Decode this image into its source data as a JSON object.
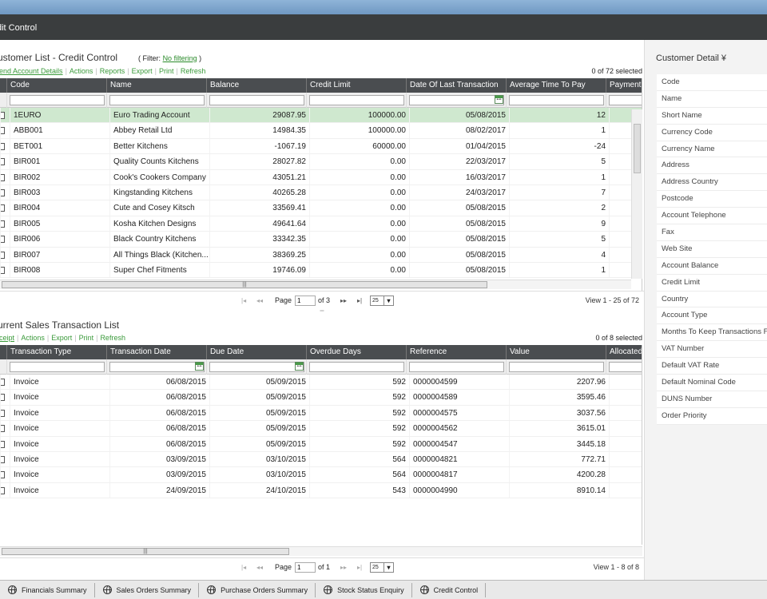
{
  "title_bar": {
    "title": "dit Control"
  },
  "customer_list": {
    "title": "ustomer List - Credit Control",
    "filter_prefix": "( Filter:",
    "filter_link": "No filtering",
    "filter_suffix": ")",
    "actions": [
      "end Account Details",
      "Actions",
      "Reports",
      "Export",
      "Print",
      "Refresh"
    ],
    "selected": "0 of 72 selected",
    "columns": [
      "Code",
      "Name",
      "Balance",
      "Credit Limit",
      "Date Of Last Transaction",
      "Average Time To Pay",
      "Payment T"
    ],
    "rows": [
      {
        "code": "1EURO",
        "name": "Euro Trading Account",
        "balance": "29087.95",
        "credit_limit": "100000.00",
        "date": "05/08/2015",
        "avg": "12"
      },
      {
        "code": "ABB001",
        "name": "Abbey Retail Ltd",
        "balance": "14984.35",
        "credit_limit": "100000.00",
        "date": "08/02/2017",
        "avg": "1"
      },
      {
        "code": "BET001",
        "name": "Better Kitchens",
        "balance": "-1067.19",
        "credit_limit": "60000.00",
        "date": "01/04/2015",
        "avg": "-24"
      },
      {
        "code": "BIR001",
        "name": "Quality Counts Kitchens",
        "balance": "28027.82",
        "credit_limit": "0.00",
        "date": "22/03/2017",
        "avg": "5"
      },
      {
        "code": "BIR002",
        "name": "Cook's Cookers Company",
        "balance": "43051.21",
        "credit_limit": "0.00",
        "date": "16/03/2017",
        "avg": "1"
      },
      {
        "code": "BIR003",
        "name": "Kingstanding Kitchens",
        "balance": "40265.28",
        "credit_limit": "0.00",
        "date": "24/03/2017",
        "avg": "7"
      },
      {
        "code": "BIR004",
        "name": "Cute and Cosey Kitsch",
        "balance": "33569.41",
        "credit_limit": "0.00",
        "date": "05/08/2015",
        "avg": "2"
      },
      {
        "code": "BIR005",
        "name": "Kosha Kitchen Designs",
        "balance": "49641.64",
        "credit_limit": "0.00",
        "date": "05/08/2015",
        "avg": "9"
      },
      {
        "code": "BIR006",
        "name": "Black Country Kitchens",
        "balance": "33342.35",
        "credit_limit": "0.00",
        "date": "05/08/2015",
        "avg": "5"
      },
      {
        "code": "BIR007",
        "name": "All Things Black (Kitchen...",
        "balance": "38369.25",
        "credit_limit": "0.00",
        "date": "05/08/2015",
        "avg": "4"
      },
      {
        "code": "BIR008",
        "name": "Super Chef Fitments",
        "balance": "19746.09",
        "credit_limit": "0.00",
        "date": "05/08/2015",
        "avg": "1"
      }
    ],
    "pager": {
      "page_label": "Page",
      "page": "1",
      "of": "of 3",
      "page_size": "25",
      "view": "View 1 - 25 of 72"
    }
  },
  "transaction_list": {
    "title": "urrent Sales Transaction List",
    "actions": [
      "ceipt",
      "Actions",
      "Export",
      "Print",
      "Refresh"
    ],
    "selected": "0 of 8 selected",
    "columns": [
      "Transaction Type",
      "Transaction Date",
      "Due Date",
      "Overdue Days",
      "Reference",
      "Value",
      "Allocated V"
    ],
    "rows": [
      {
        "type": "Invoice",
        "tdate": "06/08/2015",
        "due": "05/09/2015",
        "overdue": "592",
        "ref": "0000004599",
        "value": "2207.96"
      },
      {
        "type": "Invoice",
        "tdate": "06/08/2015",
        "due": "05/09/2015",
        "overdue": "592",
        "ref": "0000004589",
        "value": "3595.46"
      },
      {
        "type": "Invoice",
        "tdate": "06/08/2015",
        "due": "05/09/2015",
        "overdue": "592",
        "ref": "0000004575",
        "value": "3037.56"
      },
      {
        "type": "Invoice",
        "tdate": "06/08/2015",
        "due": "05/09/2015",
        "overdue": "592",
        "ref": "0000004562",
        "value": "3615.01"
      },
      {
        "type": "Invoice",
        "tdate": "06/08/2015",
        "due": "05/09/2015",
        "overdue": "592",
        "ref": "0000004547",
        "value": "3445.18"
      },
      {
        "type": "Invoice",
        "tdate": "03/09/2015",
        "due": "03/10/2015",
        "overdue": "564",
        "ref": "0000004821",
        "value": "772.71"
      },
      {
        "type": "Invoice",
        "tdate": "03/09/2015",
        "due": "03/10/2015",
        "overdue": "564",
        "ref": "0000004817",
        "value": "4200.28"
      },
      {
        "type": "Invoice",
        "tdate": "24/09/2015",
        "due": "24/10/2015",
        "overdue": "543",
        "ref": "0000004990",
        "value": "8910.14"
      }
    ],
    "pager": {
      "page_label": "Page",
      "page": "1",
      "of": "of 1",
      "page_size": "25",
      "view": "View 1 - 8 of 8"
    }
  },
  "customer_detail": {
    "title": "Customer Detail",
    "fields": [
      "Code",
      "Name",
      "Short Name",
      "Currency Code",
      "Currency Name",
      "Address",
      "Address Country",
      "Postcode",
      "Account Telephone",
      "Fax",
      "Web Site",
      "Account Balance",
      "Credit Limit",
      "Country",
      "Account Type",
      "Months To Keep Transactions F",
      "VAT Number",
      "Default VAT Rate",
      "Default Nominal Code",
      "DUNS Number",
      "Order Priority"
    ]
  },
  "bottom_tabs": [
    "Financials Summary",
    "Sales Orders Summary",
    "Purchase Orders Summary",
    "Stock Status Enquiry",
    "Credit Control"
  ],
  "colors": {
    "accent_green": "#3a9a3a",
    "selected_row": "#cfe8cf",
    "header_dark": "#4a4d50"
  }
}
